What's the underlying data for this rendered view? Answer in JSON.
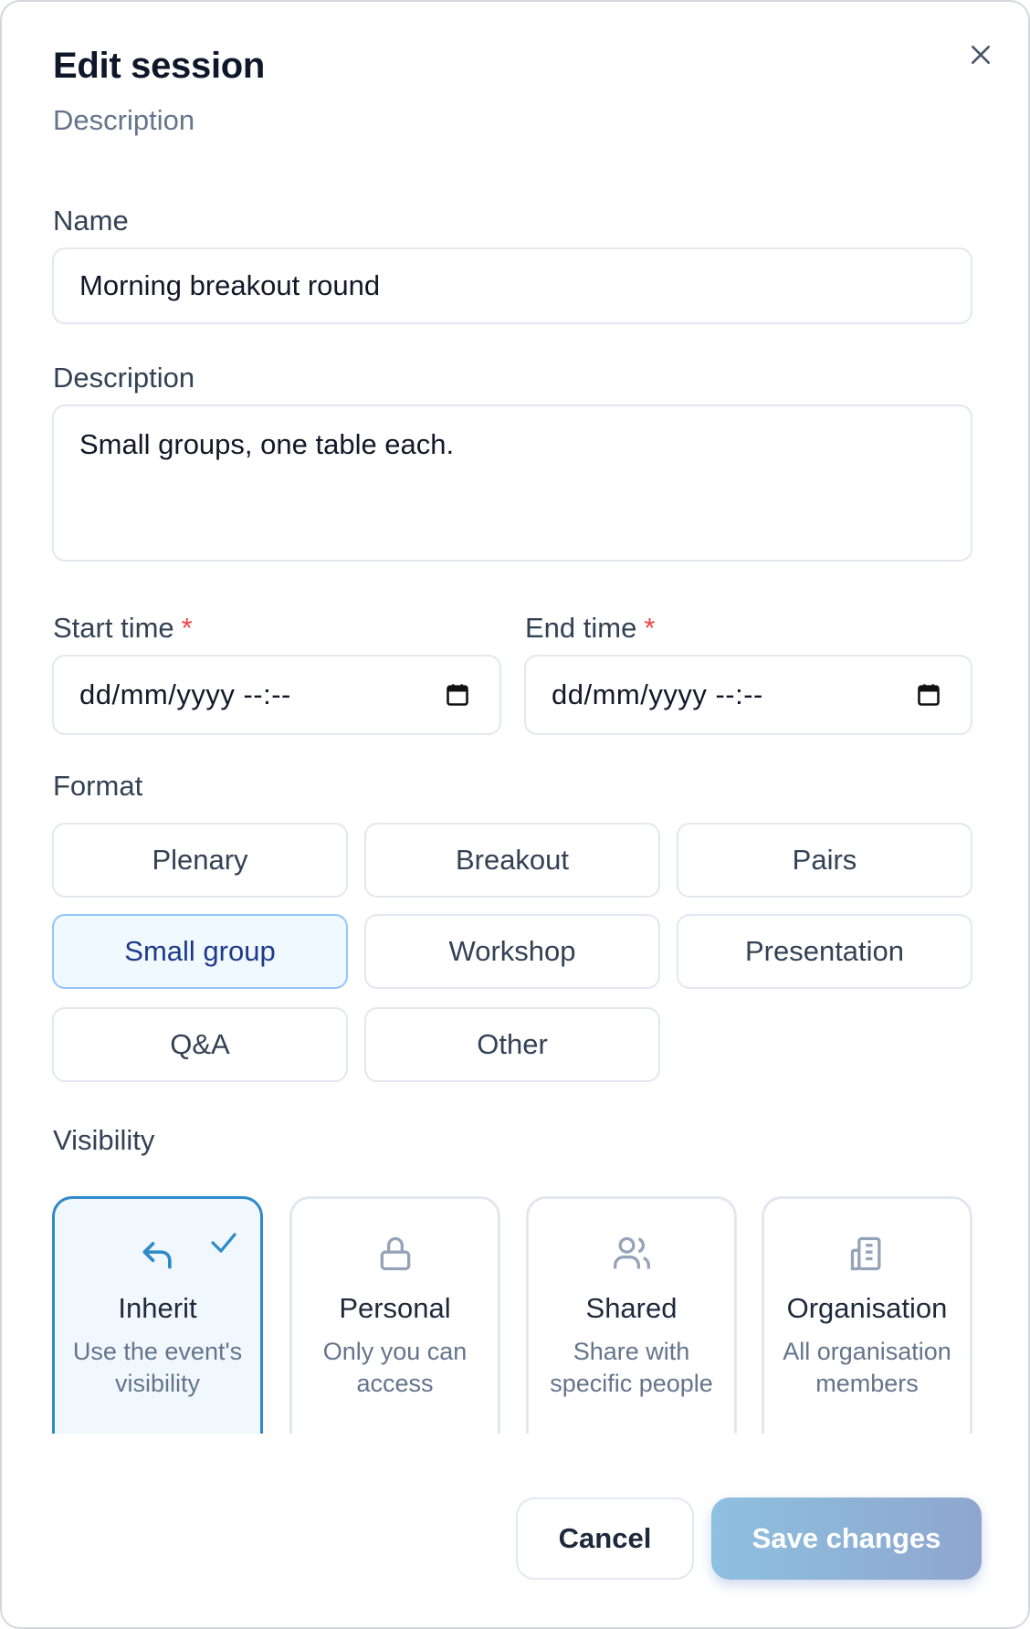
{
  "dialog": {
    "title": "Edit session",
    "subtitle": "Description"
  },
  "form": {
    "name_label": "Name",
    "name_value": "Morning breakout round",
    "description_label": "Description",
    "description_value": "Small groups, one table each.",
    "start_label": "Start time",
    "end_label": "End time",
    "required_mark": "*",
    "start_placeholder": "dd/mm/yyyy --:--",
    "end_placeholder": "dd/mm/yyyy --:--"
  },
  "format": {
    "label": "Format",
    "options": [
      "Plenary",
      "Breakout",
      "Pairs",
      "Small group",
      "Workshop",
      "Presentation",
      "Q&A",
      "Other"
    ],
    "selected": "Small group"
  },
  "visibility": {
    "label": "Visibility",
    "options": [
      {
        "title": "Inherit",
        "description": "Use the event's visibility",
        "icon": "return-arrow-icon",
        "selected": true
      },
      {
        "title": "Personal",
        "description": "Only you can access",
        "icon": "lock-icon",
        "selected": false
      },
      {
        "title": "Shared",
        "description": "Share with specific people",
        "icon": "users-icon",
        "selected": false
      },
      {
        "title": "Organisation",
        "description": "All organisation members",
        "icon": "building-icon",
        "selected": false
      }
    ]
  },
  "actions": {
    "cancel": "Cancel",
    "save": "Save changes"
  },
  "colors": {
    "accent": "#2f8ac9",
    "required": "#ef4444",
    "selected_bg": "#f0f9ff"
  }
}
